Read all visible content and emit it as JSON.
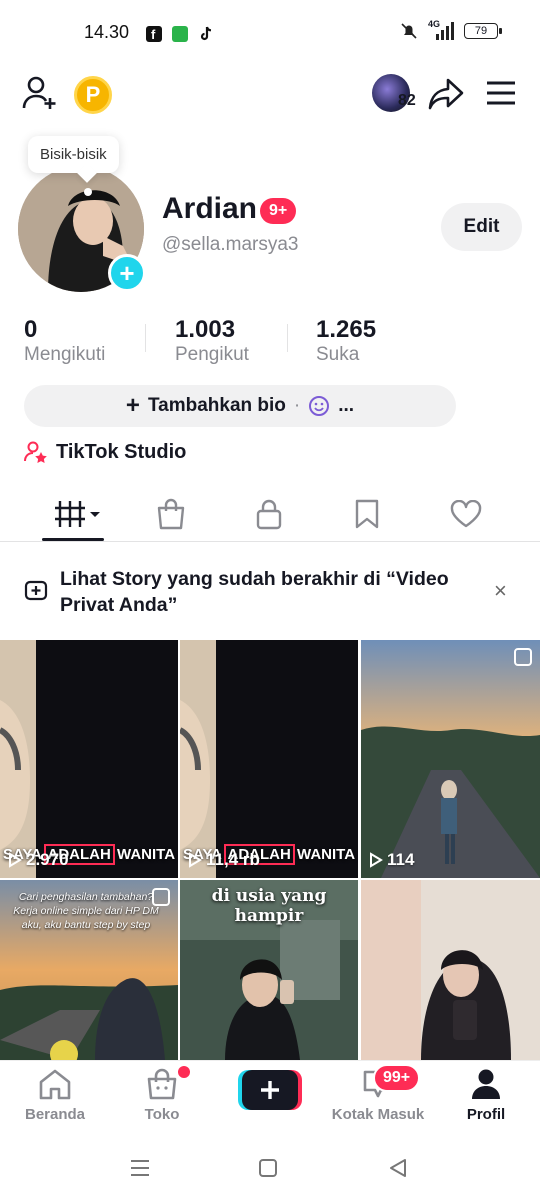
{
  "status_bar": {
    "time": "14.30",
    "network": "4G",
    "battery": "79"
  },
  "header": {
    "coin_label": "P",
    "notification_count": "82"
  },
  "profile": {
    "tooltip": "Bisik-bisik",
    "display_name": "Ardian",
    "name_badge": "9+",
    "username": "@sella.marsya3",
    "edit_label": "Edit"
  },
  "stats": [
    {
      "value": "0",
      "label": "Mengikuti"
    },
    {
      "value": "1.003",
      "label": "Pengikut"
    },
    {
      "value": "1.265",
      "label": "Suka"
    }
  ],
  "bio_button": {
    "label": "Tambahkan bio",
    "dot": "·",
    "more": "..."
  },
  "studio": {
    "label": "TikTok Studio"
  },
  "notice": {
    "text": "Lihat Story yang sudah berakhir di “Video Privat Anda”",
    "close": "×"
  },
  "videos": [
    {
      "views": "2.970",
      "caption_a": "SAYA",
      "caption_b": "ADALAH",
      "caption_c": "WANITA"
    },
    {
      "views": "11,4 rb",
      "caption_a": "SAYA",
      "caption_b": "ADALAH",
      "caption_c": "WANITA"
    },
    {
      "views": "114"
    },
    {
      "caption": "Cari penghasilan tambahan? Kerja online simple dari HP DM aku, aku bantu step by step"
    },
    {
      "caption": "di usia yang hampir"
    },
    {}
  ],
  "nav": {
    "home": "Beranda",
    "shop": "Toko",
    "inbox": "Kotak Masuk",
    "inbox_badge": "99+",
    "profile": "Profil"
  },
  "colors": {
    "accent": "#fe2c55",
    "cyan": "#20d5ec",
    "coin": "#f7b500"
  }
}
